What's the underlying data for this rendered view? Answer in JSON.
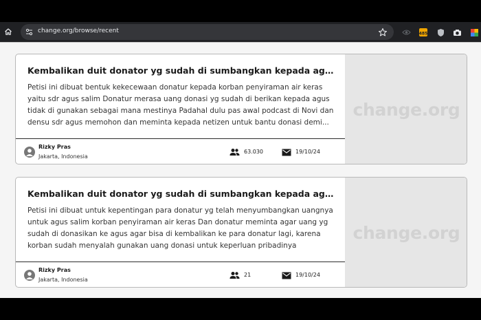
{
  "browser": {
    "url": "change.org/browse/recent",
    "extension_badge": "485"
  },
  "petitions": [
    {
      "title": "Kembalikan duit donator yg sudah di sumbangkan kepada agus korban penyiraman air keras",
      "description_lines": [
        "Petisi ini dibuat bentuk kekecewaan donatur kepada korban penyiraman air keras",
        "yaitu sdr agus salim Donatur merasa uang donasi yg sudah di berikan kepada agus",
        "tidak di gunakan sebagai mana mestinya Padahal dulu pas awal podcast di Novi dan",
        "densu sdr agus memohon dan meminta kepada netizen untuk bantu donasi demi..."
      ],
      "author": "Rizky Pras",
      "location": "Jakarta, Indonesia",
      "supporters": "63.030",
      "date": "19/10/24",
      "media_watermark": "change.org"
    },
    {
      "title": "Kembalikan duit donator yg sudah di sumbangkan kepada agus korban penyiraman air keras",
      "description_lines": [
        "Petisi ini dibuat untuk kepentingan para donatur yg telah menyumbangkan uangnya",
        "untuk agus salim korban penyiraman air keras Dan donatur meminta agar uang yg",
        "sudah di donasikan ke agus agar bisa di kembalikan ke para donatur lagi, karena",
        "korban sudah menyalah gunakan uang donasi untuk keperluan pribadinya"
      ],
      "author": "Rizky Pras",
      "location": "Jakarta, Indonesia",
      "supporters": "21",
      "date": "19/10/24",
      "media_watermark": "change.org"
    }
  ],
  "icons": {
    "home": "home-icon",
    "site_info": "tune-icon",
    "bookmark": "star-icon",
    "supporters": "people-icon",
    "mail": "mail-icon",
    "avatar": "person-icon"
  },
  "colors": {
    "toolbar": "#202124",
    "omnibox": "#35363a",
    "page_bg": "#f5f5f5",
    "watermark": "#d2d2d2"
  }
}
